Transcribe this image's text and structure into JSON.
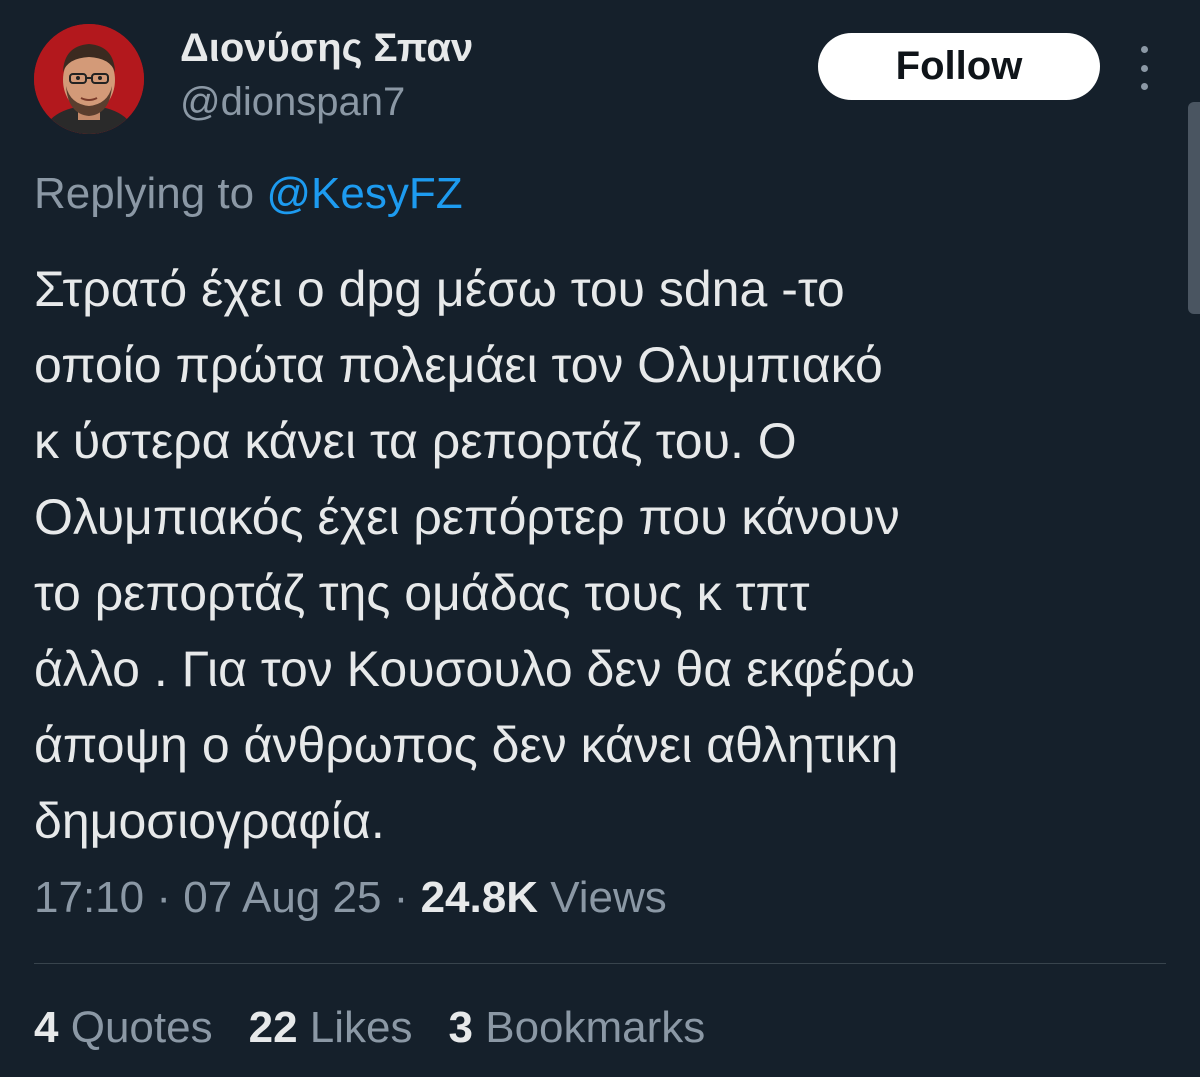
{
  "author": {
    "display_name": "Διονύσης Σπαν",
    "handle": "@dionspan7"
  },
  "header": {
    "follow_label": "Follow",
    "more_icon": "more-vertical-icon"
  },
  "reply": {
    "prefix": "Replying to",
    "mention": "@KesyFZ"
  },
  "tweet": {
    "lines": [
      "Στρατό έχει ο dpg μέσω του sdna -το",
      "οποίο πρώτα πολεμάει τον Ολυμπιακό",
      "κ ύστερα κάνει τα ρεπορτάζ του. Ο",
      "Ολυμπιακός έχει ρεπόρτερ που κάνουν",
      "το ρεπορτάζ της ομάδας τους κ τπτ",
      "άλλο . Για τον Κουσουλο δεν θα εκφέρω",
      "άποψη ο άνθρωπος δεν κάνει αθλητικη",
      "δημοσιογραφία."
    ]
  },
  "meta": {
    "time": "17:10",
    "date": "07 Aug 25",
    "separator": "·",
    "views_count": "24.8K",
    "views_label": "Views"
  },
  "stats": {
    "quotes_count": "4",
    "quotes_label": "Quotes",
    "likes_count": "22",
    "likes_label": "Likes",
    "bookmarks_count": "3",
    "bookmarks_label": "Bookmarks"
  },
  "colors": {
    "background": "#15202b",
    "link": "#1d9bf0",
    "secondary_text": "#8b98a5",
    "primary_text": "#e7e9ea"
  }
}
